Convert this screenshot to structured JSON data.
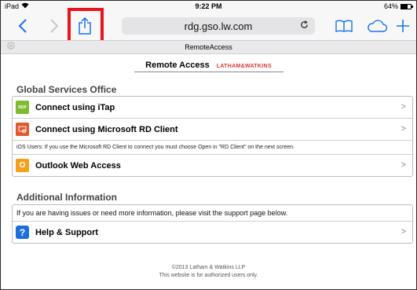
{
  "status": {
    "device": "iPad",
    "time": "9:22 PM",
    "battery": "64%",
    "battery_level": 0.64
  },
  "toolbar": {
    "url": "rdg.gso.lw.com"
  },
  "tab": {
    "title": "RemoteAccess"
  },
  "brand": {
    "title": "Remote Access",
    "logo_text": "LATHAM&WATKINS"
  },
  "sections": {
    "global": {
      "heading": "Global Services Office",
      "itap": {
        "label": "Connect using iTap",
        "icon_text": "RDP"
      },
      "msrd": {
        "label": "Connect using Microsoft RD Client"
      },
      "note": "iOS Users: If you use the Microsoft RD Client to connect you must choose Open in \"RD Client\" on the next screen.",
      "owa": {
        "label": "Outlook Web Access"
      }
    },
    "additional": {
      "heading": "Additional Information",
      "info": "If you are having issues or need more information, please visit the support page below.",
      "help": {
        "label": "Help & Support"
      }
    }
  },
  "footer": {
    "line1": "©2013 Latham & Watkins LLP",
    "line2": "This website is for authorized users only."
  },
  "icons": {
    "wifi": "wifi-icon",
    "back": "chevron-left-icon",
    "forward": "chevron-right-icon",
    "share": "share-icon",
    "reload": "reload-icon",
    "bookmarks": "book-icon",
    "cloud": "cloud-icon",
    "new_tab": "plus-icon",
    "close_tab": "close-icon",
    "chevron": "chevron-right-icon"
  },
  "colors": {
    "accent": "#1a73e8",
    "highlight": "#e8141b",
    "brand_red": "#dd3333"
  }
}
